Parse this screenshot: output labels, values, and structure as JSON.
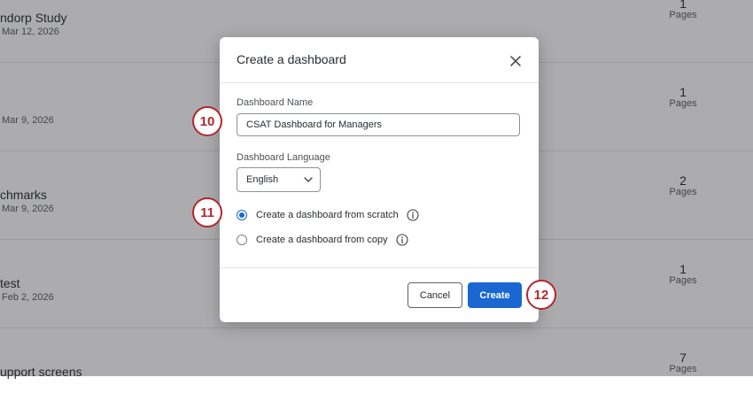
{
  "background_list": {
    "rows": [
      {
        "name": "ndorp Study",
        "date": "Mar 12, 2026",
        "pages_count": "1",
        "pages_label": "Pages"
      },
      {
        "name": "",
        "date": "Mar 9, 2026",
        "pages_count": "1",
        "pages_label": "Pages"
      },
      {
        "name": "chmarks",
        "date": "Mar 9, 2026",
        "pages_count": "2",
        "pages_label": "Pages"
      },
      {
        "name": "test",
        "date": "Feb 2, 2026",
        "pages_count": "1",
        "pages_label": "Pages"
      },
      {
        "name": "upport screens",
        "date": "",
        "pages_count": "7",
        "pages_label": "Pages"
      }
    ]
  },
  "modal": {
    "title": "Create a dashboard",
    "close_icon": "close-icon",
    "name_field": {
      "label": "Dashboard Name",
      "value": "CSAT Dashboard for Managers"
    },
    "language_field": {
      "label": "Dashboard Language",
      "value": "English",
      "icon": "chevron-down-icon"
    },
    "options": [
      {
        "label": "Create a dashboard from scratch",
        "checked": true,
        "icon": "info-icon"
      },
      {
        "label": "Create a dashboard from copy",
        "checked": false,
        "icon": "info-icon"
      }
    ],
    "buttons": {
      "cancel": "Cancel",
      "create": "Create"
    }
  },
  "step_badges": {
    "name": "10",
    "options": "11",
    "create": "12"
  },
  "colors": {
    "primary": "#1a67d2",
    "badge": "#b4262e",
    "overlay": "rgba(24,26,30,0.36)"
  }
}
